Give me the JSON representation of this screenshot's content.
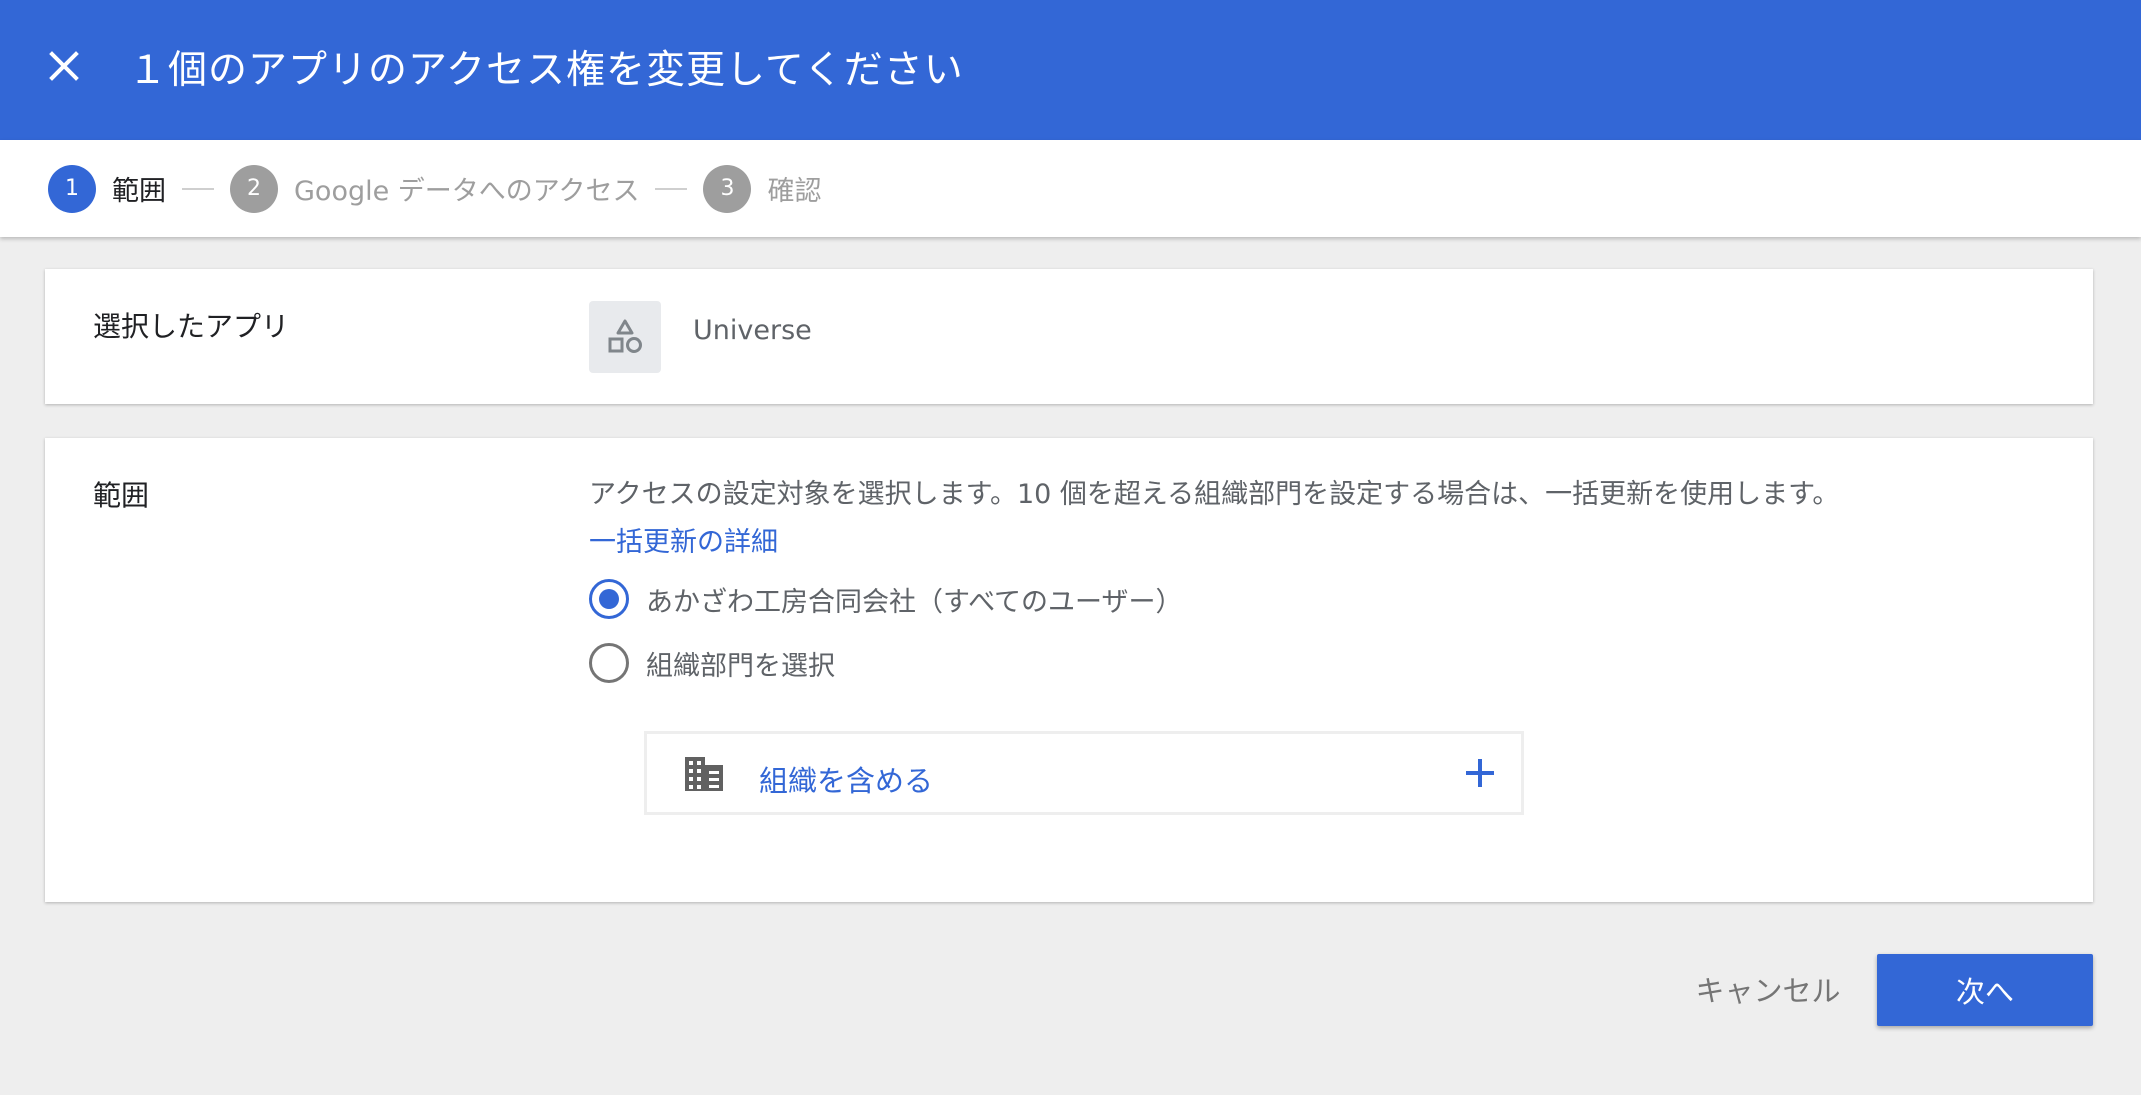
{
  "header": {
    "title": "１個のアプリのアクセス権を変更してください",
    "close_icon": "close-icon"
  },
  "stepper": {
    "steps": [
      {
        "number": "1",
        "label": "範囲",
        "active": true
      },
      {
        "number": "2",
        "label": "Google データへのアクセス",
        "active": false
      },
      {
        "number": "3",
        "label": "確認",
        "active": false
      }
    ]
  },
  "selected_app": {
    "label": "選択したアプリ",
    "app_name": "Universe",
    "icon": "shapes-icon"
  },
  "scope": {
    "label": "範囲",
    "description": "アクセスの設定対象を選択します。10 個を超える組織部門を設定する場合は、一括更新を使用します。",
    "link": "一括更新の詳細",
    "options": [
      {
        "label": "あかざわ工房合同会社（すべてのユーザー）",
        "checked": true
      },
      {
        "label": "組織部門を選択",
        "checked": false
      }
    ],
    "include_label": "組織を含める"
  },
  "footer": {
    "cancel_label": "キャンセル",
    "next_label": "次へ"
  },
  "colors": {
    "primary": "#3367d6",
    "background": "#eeeeee",
    "muted": "#9e9e9e"
  }
}
